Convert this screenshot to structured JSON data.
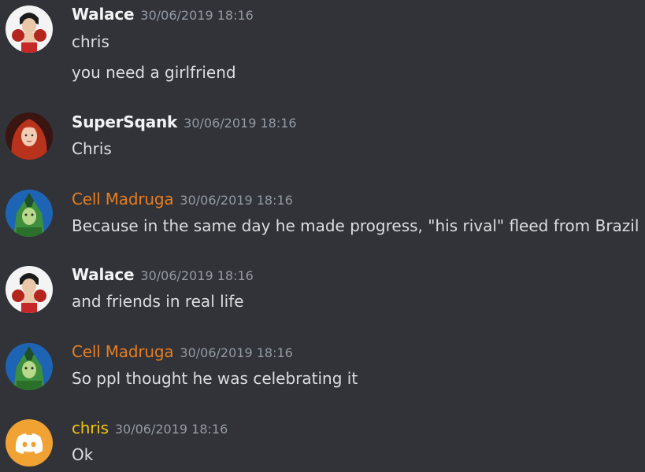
{
  "messages": [
    {
      "author": "Walace",
      "timestamp": "30/06/2019 18:16",
      "lines": [
        "chris",
        "you need a girlfriend"
      ],
      "avatar": "boxer-avatar-icon"
    },
    {
      "author": "SuperSqank",
      "timestamp": "30/06/2019 18:16",
      "lines": [
        "Chris"
      ],
      "avatar": "red-haired-woman-avatar-icon"
    },
    {
      "author": "Cell Madruga",
      "timestamp": "30/06/2019 18:16",
      "lines": [
        "Because in the same day he made progress, \"his rival\" fleed from Brazil"
      ],
      "avatar": "cell-avatar-icon",
      "name_color": "#e67e22"
    },
    {
      "author": "Walace",
      "timestamp": "30/06/2019 18:16",
      "lines": [
        "and friends in real life"
      ],
      "avatar": "boxer-avatar-icon"
    },
    {
      "author": "Cell Madruga",
      "timestamp": "30/06/2019 18:16",
      "lines": [
        "So ppl thought he was celebrating it"
      ],
      "avatar": "cell-avatar-icon",
      "name_color": "#e67e22"
    },
    {
      "author": "chris",
      "timestamp": "30/06/2019 18:16",
      "lines": [
        "Ok"
      ],
      "avatar": "discord-logo-avatar-icon",
      "name_color": "#f1c40f"
    }
  ],
  "colors": {
    "background": "#313338",
    "text": "#dbdee1",
    "timestamp": "#949ba4",
    "discord_orange": "#f0a232"
  }
}
